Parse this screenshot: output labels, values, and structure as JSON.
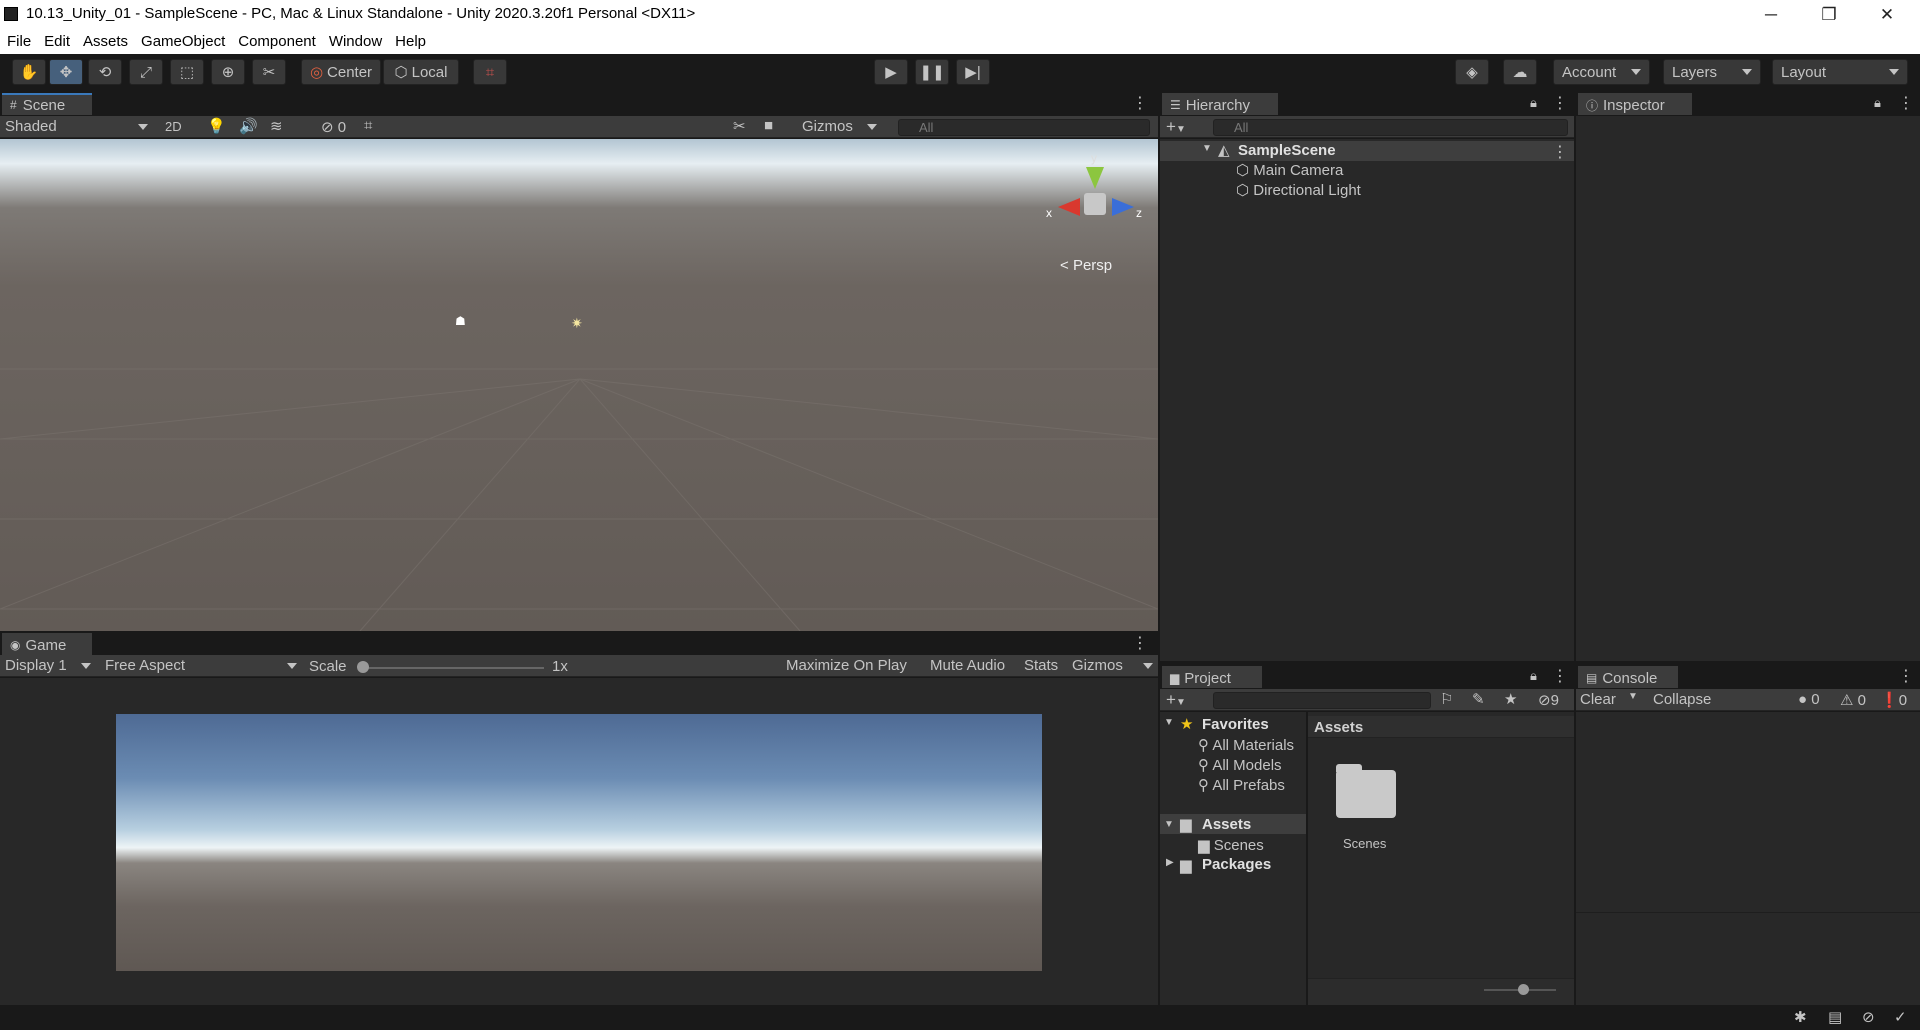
{
  "window": {
    "title": "10.13_Unity_01 - SampleScene - PC, Mac & Linux Standalone - Unity 2020.3.20f1 Personal <DX11>",
    "minimize": "─",
    "maximize": "❐",
    "close": "✕"
  },
  "menu": [
    "File",
    "Edit",
    "Assets",
    "GameObject",
    "Component",
    "Window",
    "Help"
  ],
  "toolbar": {
    "pivot": "Center",
    "space": "Local",
    "account": "Account",
    "layers": "Layers",
    "layout": "Layout"
  },
  "scene": {
    "tab": "Scene",
    "shading": "Shaded",
    "mode2d": "2D",
    "hidden_count": "0",
    "gizmos": "Gizmos",
    "search_placeholder": "All",
    "persp": "Persp",
    "axis_x": "x",
    "axis_y": "y",
    "axis_z": "z"
  },
  "game": {
    "tab": "Game",
    "display": "Display 1",
    "aspect": "Free Aspect",
    "scale_label": "Scale",
    "scale_value": "1x",
    "maximize": "Maximize On Play",
    "mute": "Mute Audio",
    "stats": "Stats",
    "gizmos": "Gizmos"
  },
  "hierarchy": {
    "tab": "Hierarchy",
    "search_placeholder": "All",
    "scene": "SampleScene",
    "items": [
      "Main Camera",
      "Directional Light"
    ]
  },
  "inspector": {
    "tab": "Inspector"
  },
  "project": {
    "tab": "Project",
    "hidden_count": "9",
    "favorites": "Favorites",
    "fav_items": [
      "All Materials",
      "All Models",
      "All Prefabs"
    ],
    "assets": "Assets",
    "asset_children": [
      "Scenes"
    ],
    "packages": "Packages",
    "breadcrumb": "Assets",
    "folder": "Scenes"
  },
  "console": {
    "tab": "Console",
    "clear": "Clear",
    "collapse": "Collapse",
    "info_count": "0",
    "warn_count": "0",
    "error_count": "0"
  },
  "colors": {
    "accent": "#3a79bb",
    "panel": "#282828",
    "toolbar": "#191919"
  }
}
